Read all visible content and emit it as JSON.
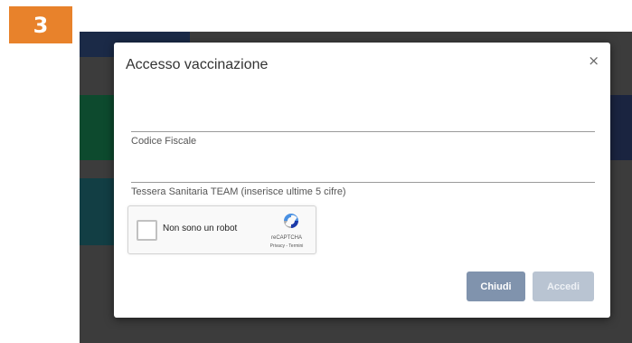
{
  "step_badge": "3",
  "modal": {
    "title": "Accesso vaccinazione",
    "close_icon": "×",
    "fields": [
      {
        "label": "Codice Fiscale",
        "value": ""
      },
      {
        "label": "Tessera Sanitaria TEAM (inserisce ultime 5 cifre)",
        "value": ""
      }
    ],
    "captcha": {
      "label": "Non sono un robot",
      "brand": "reCAPTCHA",
      "links": "Privacy - Termini",
      "logo_icon": "recaptcha-icon"
    },
    "buttons": {
      "close_label": "Chiudi",
      "login_label": "Accedi"
    }
  },
  "colors": {
    "badge": "#e8822b",
    "close_button": "#8093ad",
    "login_button_disabled": "#b9c4d2",
    "backdrop": "#3c3c3c"
  }
}
